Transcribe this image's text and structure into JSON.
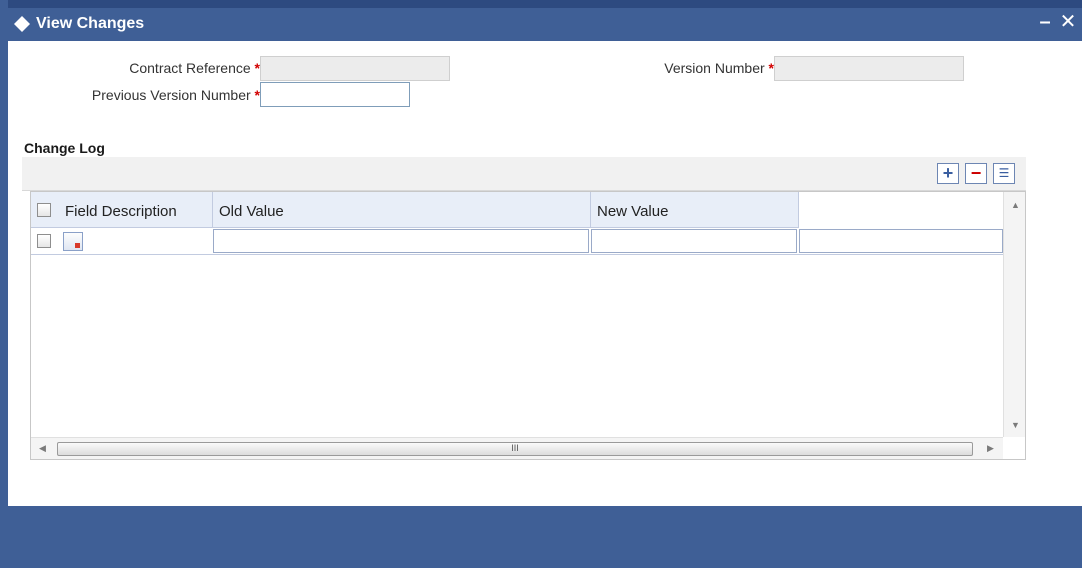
{
  "window": {
    "title": "View Changes",
    "minimize_glyph": "–",
    "close_glyph": "✕"
  },
  "form": {
    "contract_reference": {
      "label": "Contract Reference",
      "required_mark": "*",
      "value": ""
    },
    "version_number": {
      "label": "Version Number",
      "required_mark": "*",
      "value": ""
    },
    "previous_version_number": {
      "label": "Previous Version Number",
      "required_mark": "*",
      "value": ""
    }
  },
  "change_log": {
    "title": "Change Log",
    "toolbar": {
      "add_glyph": "+",
      "delete_glyph": "−",
      "list_glyph": "☰"
    },
    "columns": [
      "Field Description",
      "Old Value",
      "New Value"
    ],
    "rows": [
      {
        "field_description": "",
        "old_value": "",
        "new_value": "",
        "extra": ""
      }
    ],
    "hscroll_grip": "III"
  },
  "colors": {
    "titlebar": "#3f5f96",
    "required": "#d20000",
    "header_bg": "#e8eef8"
  }
}
